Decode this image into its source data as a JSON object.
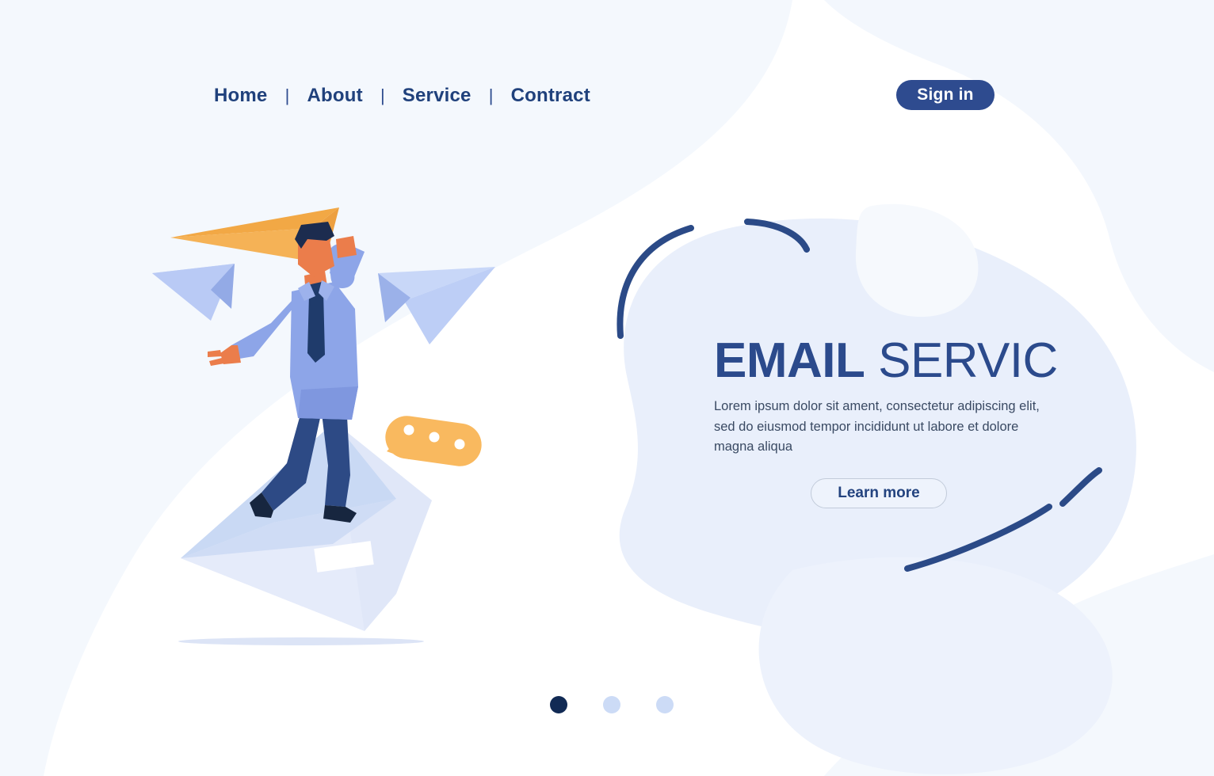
{
  "page": {
    "background_color": "#ffffff",
    "accent_navy": "#2b4a8c",
    "accent_dark_navy": "#112a54",
    "accent_orange": "#f5a93f",
    "blob_light_blue": "#e8eefb",
    "blob_pale_blue": "#f2f6fd"
  },
  "nav": {
    "items": [
      {
        "label": "Home"
      },
      {
        "label": "About"
      },
      {
        "label": "Service"
      },
      {
        "label": "Contract"
      }
    ],
    "separator": "|",
    "signin_label": "Sign in"
  },
  "hero": {
    "title_bold": "EMAIL",
    "title_regular": " SERVIC",
    "subtitle": "Lorem ipsum dolor sit ament, consectetur adipiscing elit, sed do eiusmod tempor incididunt ut labore et dolore magna aliqua",
    "cta_label": "Learn more"
  },
  "carousel": {
    "dots": [
      {
        "state": "active"
      },
      {
        "state": "inactive"
      },
      {
        "state": "inactive"
      }
    ]
  },
  "illustration": {
    "name": "man-holding-paper-plane-on-envelope",
    "elements": [
      "orange-paper-plane",
      "businessman-character",
      "left-paper-plane",
      "right-paper-plane",
      "open-envelope",
      "orange-chat-bubble",
      "ground-shadow"
    ],
    "colors": {
      "skin": "#eb7d4b",
      "hair": "#1c2c4f",
      "shirt": "#8da5e8",
      "shirt_shade": "#7f97df",
      "tie": "#1f3b6b",
      "trousers": "#2d4a85",
      "shoes": "#17263f",
      "plane_orange": "#f5a93f",
      "plane_orange_dark": "#e89b33",
      "plane_blue": "#c2d2f7",
      "plane_blue_dark": "#93aae6",
      "envelope_front": "#e3e9fa",
      "envelope_flap": "#c7d7f3",
      "bubble": "#f9b95f"
    }
  }
}
